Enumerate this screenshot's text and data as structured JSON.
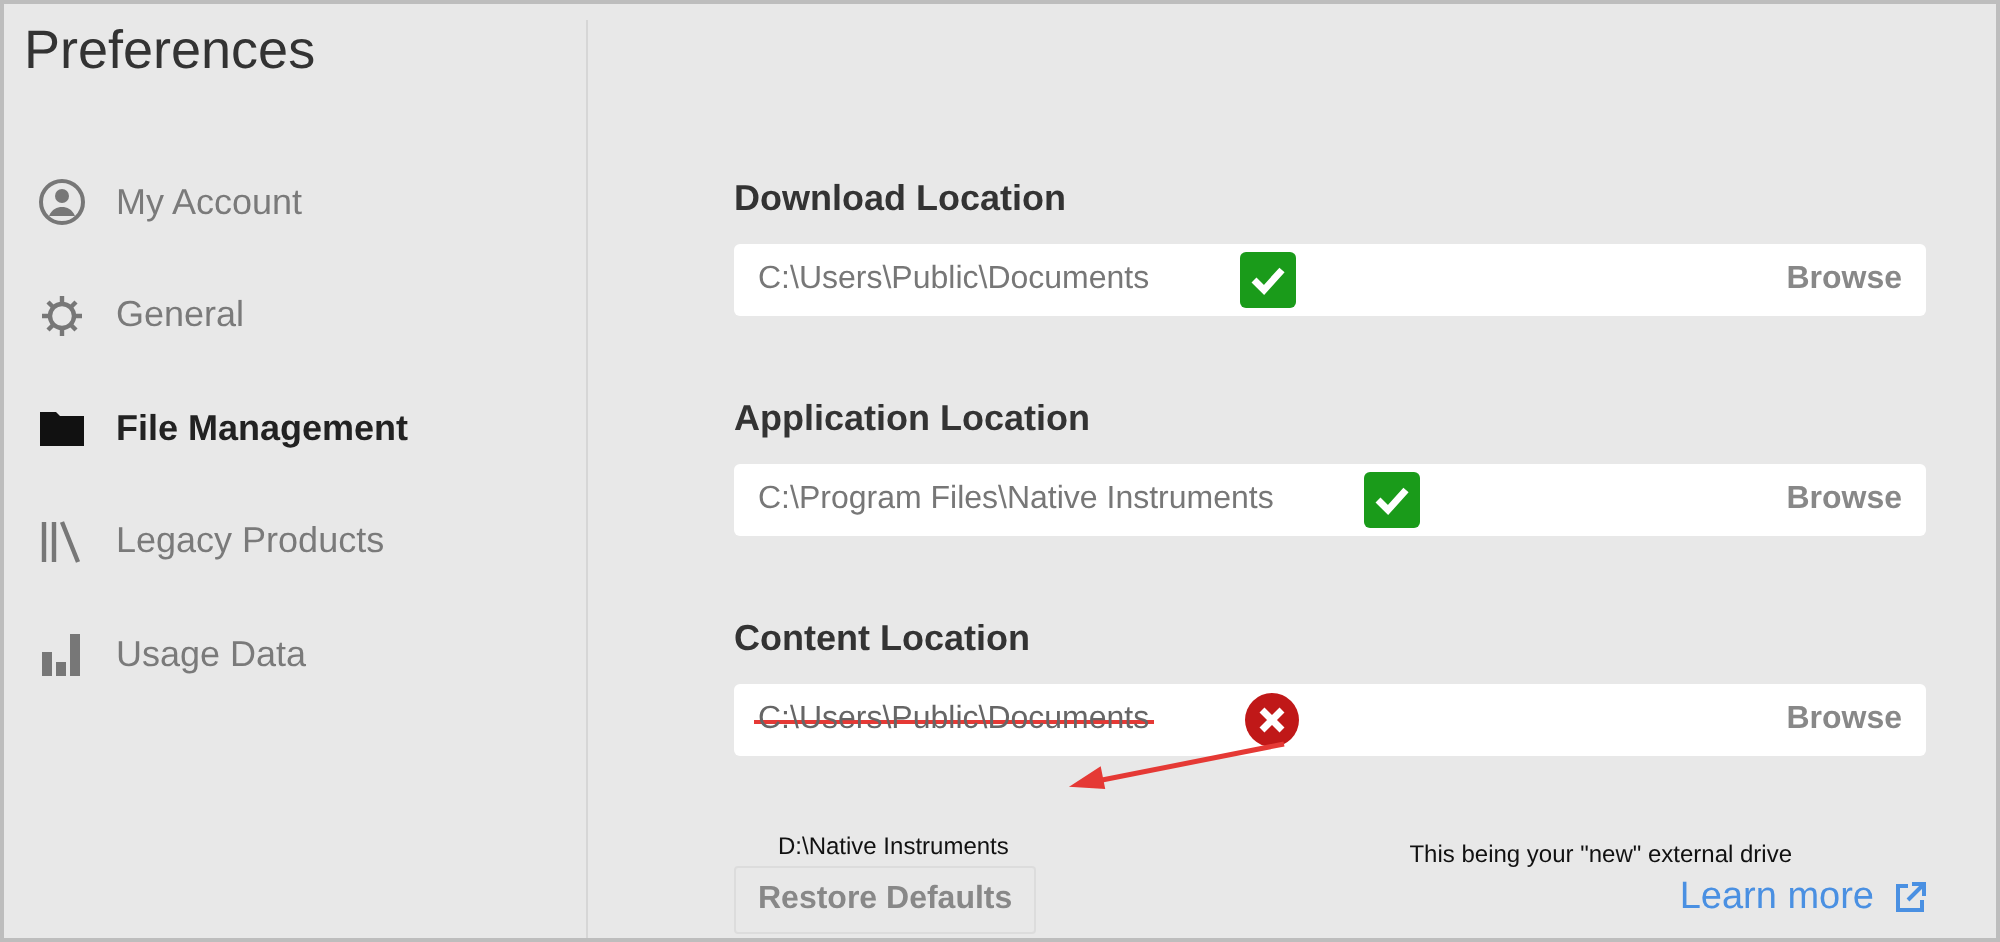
{
  "window": {
    "title": "Preferences"
  },
  "sidebar": {
    "items": [
      {
        "label": "My Account",
        "selected": false
      },
      {
        "label": "General",
        "selected": false
      },
      {
        "label": "File Management",
        "selected": true
      },
      {
        "label": "Legacy Products",
        "selected": false
      },
      {
        "label": "Usage Data",
        "selected": false
      }
    ]
  },
  "locations": [
    {
      "heading": "Download Location",
      "path": "C:\\Users\\Public\\Documents",
      "valid": true,
      "struck": false,
      "action": "Browse"
    },
    {
      "heading": "Application Location",
      "path": "C:\\Program Files\\Native Instruments",
      "valid": true,
      "struck": false,
      "action": "Browse"
    },
    {
      "heading": "Content Location",
      "path": "C:\\Users\\Public\\Documents",
      "valid": false,
      "struck": true,
      "action": "Browse"
    }
  ],
  "annotations": {
    "new_path": "D:\\Native Instruments",
    "note": "This being your \"new\" external drive"
  },
  "restore_button": "Restore Defaults",
  "learn_more": "Learn more"
}
